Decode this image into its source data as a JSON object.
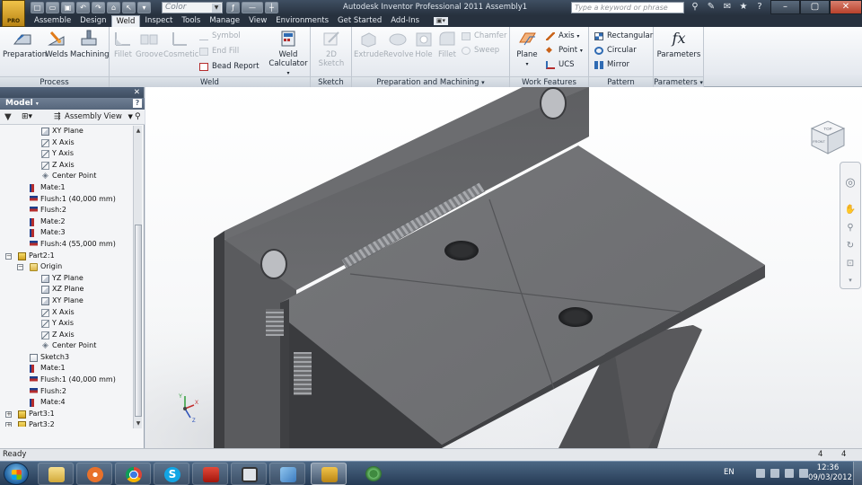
{
  "window": {
    "title": "Autodesk Inventor Professional 2011   Assembly1",
    "app_logo_text": "PRO",
    "color_combo": "Color",
    "search_placeholder": "Type a keyword or phrase"
  },
  "tabs": [
    "Assemble",
    "Design",
    "Weld",
    "Inspect",
    "Tools",
    "Manage",
    "View",
    "Environments",
    "Get Started",
    "Add-Ins"
  ],
  "active_tab": "Weld",
  "ribbon": {
    "process": {
      "title": "Process",
      "preparation": "Preparation",
      "welds": "Welds",
      "machining": "Machining"
    },
    "weld": {
      "title": "Weld",
      "fillet": "Fillet",
      "groove": "Groove",
      "cosmetic": "Cosmetic",
      "symbol": "Symbol",
      "end_fill": "End Fill",
      "bead_report": "Bead Report",
      "weld_calculator_1": "Weld",
      "weld_calculator_2": "Calculator"
    },
    "sketch": {
      "title": "Sketch",
      "sketch_2d": "2D Sketch"
    },
    "prep": {
      "title": "Preparation and Machining",
      "extrude": "Extrude",
      "revolve": "Revolve",
      "hole": "Hole",
      "fillet": "Fillet",
      "chamfer": "Chamfer",
      "sweep": "Sweep"
    },
    "work": {
      "title": "Work Features",
      "plane": "Plane",
      "axis": "Axis",
      "point": "Point",
      "ucs": "UCS"
    },
    "pattern": {
      "title": "Pattern",
      "rectangular": "Rectangular",
      "circular": "Circular",
      "mirror": "Mirror"
    },
    "parameters": {
      "title": "Parameters",
      "parameters": "Parameters",
      "fx": "fx"
    }
  },
  "browser": {
    "header": "Model",
    "view_mode": "Assembly View",
    "tree": [
      {
        "label": "XY Plane",
        "icon": "plane",
        "indent": 46
      },
      {
        "label": "X Axis",
        "icon": "axis",
        "indent": 46
      },
      {
        "label": "Y Axis",
        "icon": "axis",
        "indent": 46
      },
      {
        "label": "Z Axis",
        "icon": "axis",
        "indent": 46
      },
      {
        "label": "Center Point",
        "icon": "point",
        "indent": 46
      },
      {
        "label": "Mate:1",
        "icon": "mate",
        "indent": 33
      },
      {
        "label": "Flush:1 (40,000 mm)",
        "icon": "flush",
        "indent": 33
      },
      {
        "label": "Flush:2",
        "icon": "flush",
        "indent": 33
      },
      {
        "label": "Mate:2",
        "icon": "mate",
        "indent": 33
      },
      {
        "label": "Mate:3",
        "icon": "mate",
        "indent": 33
      },
      {
        "label": "Flush:4 (55,000 mm)",
        "icon": "flush",
        "indent": 33
      },
      {
        "label": "Part2:1",
        "icon": "part",
        "indent": 20,
        "expander": "−"
      },
      {
        "label": "Origin",
        "icon": "folder",
        "indent": 33,
        "expander": "−"
      },
      {
        "label": "YZ Plane",
        "icon": "plane",
        "indent": 46
      },
      {
        "label": "XZ Plane",
        "icon": "plane",
        "indent": 46
      },
      {
        "label": "XY Plane",
        "icon": "plane",
        "indent": 46
      },
      {
        "label": "X Axis",
        "icon": "axis",
        "indent": 46
      },
      {
        "label": "Y Axis",
        "icon": "axis",
        "indent": 46
      },
      {
        "label": "Z Axis",
        "icon": "axis",
        "indent": 46
      },
      {
        "label": "Center Point",
        "icon": "point",
        "indent": 46
      },
      {
        "label": "Sketch3",
        "icon": "sketch",
        "indent": 33
      },
      {
        "label": "Mate:1",
        "icon": "mate",
        "indent": 33
      },
      {
        "label": "Flush:1 (40,000 mm)",
        "icon": "flush",
        "indent": 33
      },
      {
        "label": "Flush:2",
        "icon": "flush",
        "indent": 33
      },
      {
        "label": "Mate:4",
        "icon": "mate",
        "indent": 33
      },
      {
        "label": "Part3:1",
        "icon": "part",
        "indent": 20,
        "expander": "+"
      },
      {
        "label": "Part3:2",
        "icon": "part",
        "indent": 20,
        "expander": "+"
      }
    ]
  },
  "viewcube": {
    "face_top": "TOP",
    "face_left": "FRONT"
  },
  "triad": {
    "x": "X",
    "y": "Y",
    "z": "Z"
  },
  "status": {
    "text": "Ready",
    "count_1": "4",
    "count_2": "4"
  },
  "taskbar": {
    "language": "EN",
    "time": "12:36",
    "date": "09/03/2012"
  },
  "colors": {
    "accent_tab": "#eef1f5",
    "model_steel": "#6e6f72",
    "weld_bead": "#8a8c90"
  }
}
